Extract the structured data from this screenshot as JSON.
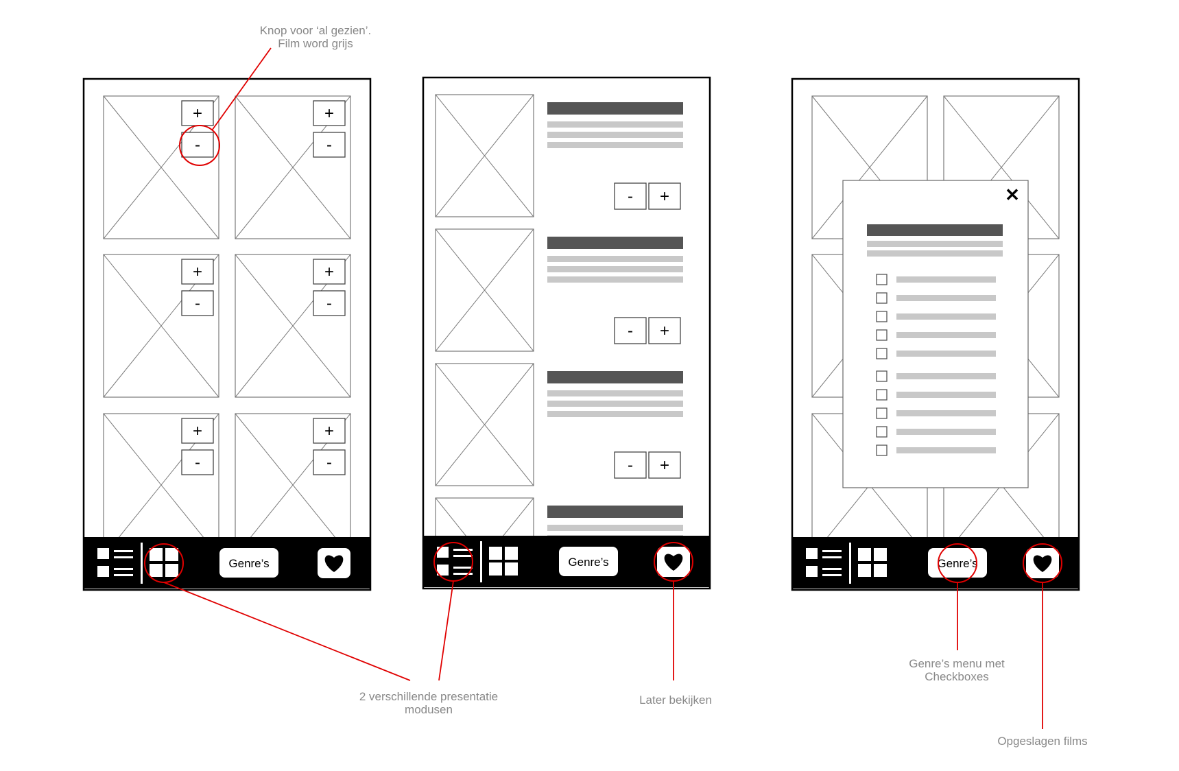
{
  "annotations": {
    "seen_button": "Knop voor ‘al gezien’.\nFilm word grijs",
    "presentation_modes": "2 verschillende presentatie\nmodusen",
    "watch_later": "Later bekijken",
    "genre_menu": "Genre’s menu met\nCheckboxes",
    "saved_films": "Opgeslagen films"
  },
  "screens": [
    {
      "layout": "grid",
      "poster_count": 6,
      "add_label": "+",
      "seen_label": "-",
      "nav": {
        "list_icon": "list-view-icon",
        "grid_icon": "grid-view-icon",
        "genre_label": "Genre’s",
        "heart_icon": "heart-icon"
      }
    },
    {
      "layout": "list",
      "item_count": 4,
      "add_label": "+",
      "seen_label": "-",
      "nav": {
        "list_icon": "list-view-icon",
        "grid_icon": "grid-view-icon",
        "genre_label": "Genre’s",
        "heart_icon": "heart-icon"
      }
    },
    {
      "layout": "grid-with-genre-modal",
      "modal": {
        "close_label": "✕",
        "checkbox_count": 10,
        "close_icon": "close-icon"
      },
      "nav": {
        "list_icon": "list-view-icon",
        "grid_icon": "grid-view-icon",
        "genre_label": "Genre’s",
        "heart_icon": "heart-icon"
      }
    }
  ],
  "colors": {
    "frame": "#000000",
    "highlight": "#e00000",
    "note_text": "#888888",
    "bar_dark": "#555555",
    "bar_light": "#c8c8c8",
    "placeholder": "#7a7a7a"
  }
}
